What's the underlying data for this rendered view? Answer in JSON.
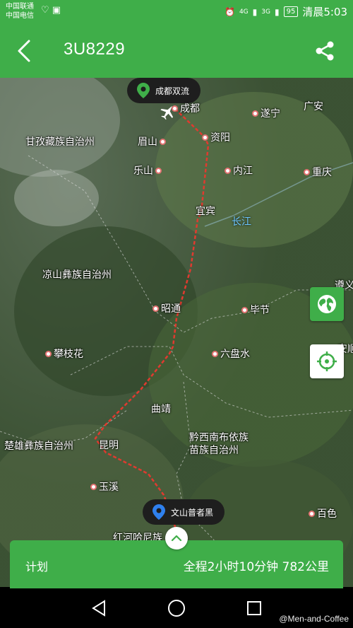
{
  "status_bar": {
    "carrier_1": "中国联通",
    "carrier_2": "中国电信",
    "net_1": "4G",
    "net_2": "3G",
    "battery": "95",
    "time": "清晨5:03"
  },
  "app_bar": {
    "title": "3U8229",
    "back_icon": "chevron-left-icon",
    "share_icon": "share-icon"
  },
  "map": {
    "origin_label": "成都双流",
    "destination_label": "文山普者黑",
    "cities": {
      "chengdu": "成都",
      "suining": "遂宁",
      "guangan": "广安",
      "ziyang": "资阳",
      "meishan": "眉山",
      "leshan": "乐山",
      "neijiang": "内江",
      "chongqing": "重庆",
      "yibin": "宜宾",
      "zhaotong": "昭通",
      "bijie": "毕节",
      "panzhihua": "攀枝花",
      "liupanshui": "六盘水",
      "qujing": "曲靖",
      "kunming": "昆明",
      "yuxi": "玉溪",
      "baise": "百色",
      "zunyi_partial": "遵义",
      "anshun_partial": "安顺"
    },
    "regions": {
      "ganzi": "甘孜藏族自治州",
      "liangshan": "凉山彝族自治州",
      "chuxiong": "楚雄彝族自治州",
      "qianxinan_1": "黔西南布依族",
      "qianxinan_2": "苗族自治州",
      "honghe": "红河哈尼族"
    },
    "river": "长江",
    "route_color": "#e03a2f",
    "accent": "#3fae49"
  },
  "plan_card": {
    "label": "计划",
    "summary": "全程2小时10分钟 782公里"
  },
  "watermark": "@Men-and-Coffee"
}
